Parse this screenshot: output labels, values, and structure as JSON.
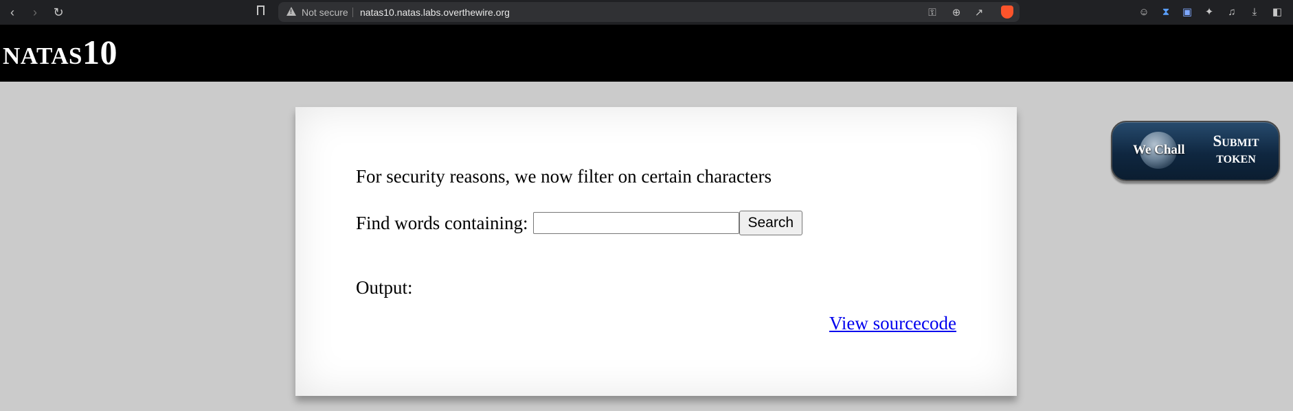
{
  "browser": {
    "security_label": "Not secure",
    "url": "natas10.natas.labs.overthewire.org"
  },
  "header": {
    "title": "natas10"
  },
  "content": {
    "notice": "For security reasons, we now filter on certain characters",
    "find_label": "Find words containing:",
    "search_value": "",
    "search_button": "Search",
    "output_label": "Output:",
    "source_link": "View sourcecode"
  },
  "badge": {
    "logo_text": "We Chall",
    "submit_line1": "Submit",
    "submit_line2": "token"
  }
}
